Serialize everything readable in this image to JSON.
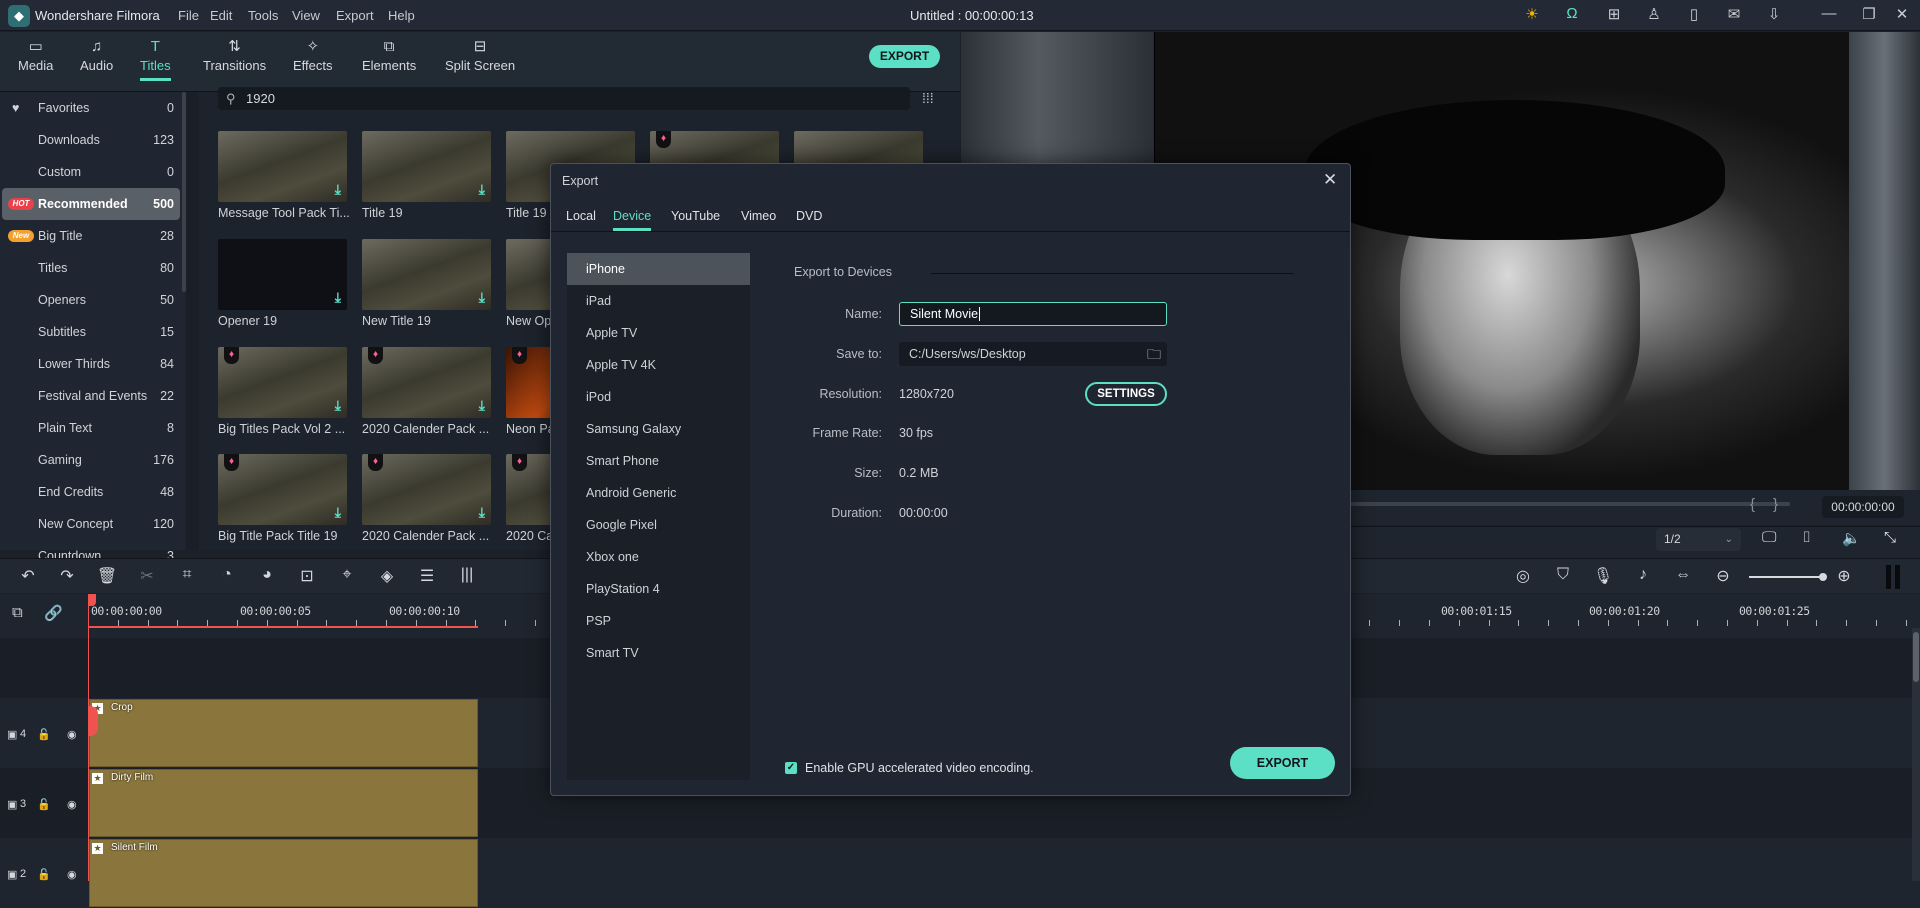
{
  "app": {
    "name": "Wondershare Filmora",
    "document_title": "Untitled : 00:00:00:13"
  },
  "menu": [
    "File",
    "Edit",
    "Tools",
    "View",
    "Export",
    "Help"
  ],
  "window_icons": [
    "lightbulb-icon",
    "headset-icon",
    "gift-icon",
    "account-icon",
    "save-icon",
    "mail-icon",
    "download-icon",
    "minimize-icon",
    "restore-icon",
    "close-icon"
  ],
  "tabs": [
    {
      "label": "Media",
      "icon": "folder-icon"
    },
    {
      "label": "Audio",
      "icon": "music-icon"
    },
    {
      "label": "Titles",
      "icon": "text-icon",
      "active": true
    },
    {
      "label": "Transitions",
      "icon": "transition-icon"
    },
    {
      "label": "Effects",
      "icon": "effects-icon"
    },
    {
      "label": "Elements",
      "icon": "elements-icon"
    },
    {
      "label": "Split Screen",
      "icon": "split-screen-icon"
    }
  ],
  "export_top_label": "EXPORT",
  "sidebar": {
    "items": [
      {
        "label": "Favorites",
        "count": "0"
      },
      {
        "label": "Downloads",
        "count": "123"
      },
      {
        "label": "Custom",
        "count": "0"
      },
      {
        "label": "Recommended",
        "count": "500",
        "badge": "HOT",
        "selected": true
      },
      {
        "label": "Big Title",
        "count": "28",
        "badge": "New"
      },
      {
        "label": "Titles",
        "count": "80"
      },
      {
        "label": "Openers",
        "count": "50"
      },
      {
        "label": "Subtitles",
        "count": "15"
      },
      {
        "label": "Lower Thirds",
        "count": "84"
      },
      {
        "label": "Festival and Events",
        "count": "22"
      },
      {
        "label": "Plain Text",
        "count": "8"
      },
      {
        "label": "Gaming",
        "count": "176"
      },
      {
        "label": "End Credits",
        "count": "48"
      },
      {
        "label": "New Concept",
        "count": "120"
      },
      {
        "label": "Countdown",
        "count": "3"
      }
    ]
  },
  "search": {
    "value": "1920"
  },
  "thumbnails": [
    [
      "Message Tool Pack Ti...",
      "Title 19",
      "Title 19",
      "",
      ""
    ],
    [
      "Opener 19",
      "New Title 19",
      "New Op",
      "",
      ""
    ],
    [
      "Big Titles Pack Vol 2 ...",
      "2020 Calender Pack ...",
      "Neon Pa",
      "",
      ""
    ],
    [
      "Big Title Pack Title 19",
      "2020 Calender Pack ...",
      "2020 Ca",
      "",
      ""
    ]
  ],
  "preview": {
    "timecode": "00:00:00:00",
    "zoom": "1/2"
  },
  "timeline": {
    "ruler": [
      "00:00:00:00",
      "00:00:00:05",
      "00:00:00:10",
      "00:00:01:15",
      "00:00:01:20",
      "00:00:01:25"
    ],
    "tracks": [
      {
        "number": "4",
        "clip": "Crop"
      },
      {
        "number": "3",
        "clip": "Dirty Film"
      },
      {
        "number": "2",
        "clip": "Silent Film"
      }
    ]
  },
  "dialog": {
    "title": "Export",
    "tabs": [
      "Local",
      "Device",
      "YouTube",
      "Vimeo",
      "DVD"
    ],
    "active_tab": "Device",
    "devices": [
      "iPhone",
      "iPad",
      "Apple TV",
      "Apple TV 4K",
      "iPod",
      "Samsung Galaxy",
      "Smart Phone",
      "Android Generic",
      "Google Pixel",
      "Xbox one",
      "PlayStation 4",
      "PSP",
      "Smart TV"
    ],
    "selected_device": "iPhone",
    "section": "Export to Devices",
    "fields": {
      "name_label": "Name:",
      "name": "Silent Movie",
      "save_label": "Save to:",
      "save_to": "C:/Users/ws/Desktop",
      "resolution_label": "Resolution:",
      "resolution": "1280x720",
      "frame_rate_label": "Frame Rate:",
      "frame_rate": "30 fps",
      "size_label": "Size:",
      "size": "0.2 MB",
      "duration_label": "Duration:",
      "duration": "00:00:00"
    },
    "settings_label": "SETTINGS",
    "gpu_label": "Enable GPU accelerated video encoding.",
    "gpu_checked": true,
    "export_label": "EXPORT"
  },
  "colors": {
    "accent": "#5ce0c5",
    "clip": "#8a763c",
    "playhead": "#f0524f"
  }
}
